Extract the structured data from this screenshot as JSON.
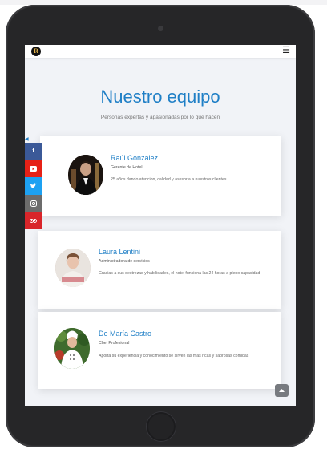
{
  "navbar": {
    "logo_letter": "R",
    "menu_icon": "hamburger-icon"
  },
  "section": {
    "title": "Nuestro equipo",
    "subtitle": "Personas expertas y apasionadas por lo que hacen"
  },
  "team": [
    {
      "name": "Raúl Gonzalez",
      "role": "Gerente de Hotel",
      "description": "25 años dando atencion, calidad y asesoria a nuestros clientes"
    },
    {
      "name": "Laura Lentini",
      "role": "Administradora de servicios",
      "description": "Gracias a sus destrezas y habilidades, el hotel funciona las 24 horas a pleno capacidad"
    },
    {
      "name": "De María Castro",
      "role": "Chef Profesional",
      "description": "Aporta su experiencia y conocimiento se sirven las mas ricas y sabrosas comidas"
    }
  ],
  "social": [
    {
      "icon": "facebook-icon",
      "color": "#3b5998"
    },
    {
      "icon": "youtube-icon",
      "color": "#e62117"
    },
    {
      "icon": "twitter-icon",
      "color": "#1da1f2"
    },
    {
      "icon": "instagram-icon",
      "color": "#6c6c6c"
    },
    {
      "icon": "tripadvisor-icon",
      "color": "#d9252a"
    }
  ],
  "colors": {
    "accent": "#1f7fc6",
    "tablet_frame": "#2b2b2d",
    "page_bg": "#f1f3f7"
  }
}
